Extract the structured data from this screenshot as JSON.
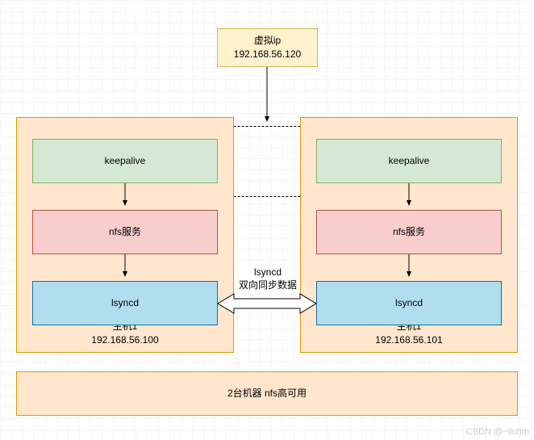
{
  "vip": {
    "label": "虚拟ip",
    "ip": "192.168.56.120"
  },
  "hosts": [
    {
      "name": "主机1",
      "ip": "192.168.56.100",
      "keepalive": "keepalive",
      "nfs": "nfs服务",
      "lsyncd": "lsyncd"
    },
    {
      "name": "主机1",
      "ip": "192.168.56.101",
      "keepalive": "keepalive",
      "nfs": "nfs服务",
      "lsyncd": "lsyncd"
    }
  ],
  "sync": {
    "line1": "lsyncd",
    "line2": "双向同步数据"
  },
  "title": "2台机器 nfs高可用",
  "watermark": "CSDN @~liuhm"
}
